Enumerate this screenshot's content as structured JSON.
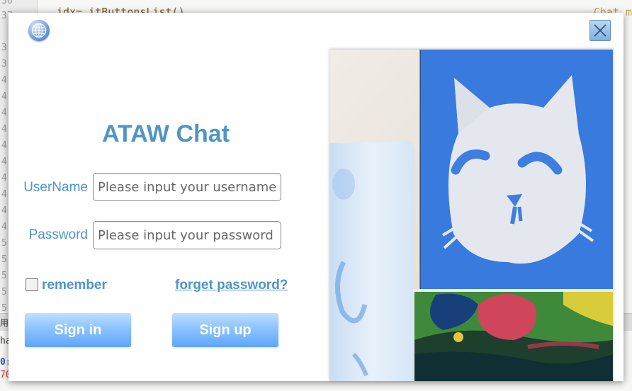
{
  "background_editor": {
    "gutter_numbers": [
      "36",
      "37",
      "3",
      "3",
      "4",
      "4",
      "4",
      "4",
      "4",
      "4",
      "4",
      "4",
      "4",
      "4",
      "5",
      "5",
      "5",
      "5",
      "5"
    ],
    "code_line": "    idx=    itButtonsList()",
    "code_right": "Chat m",
    "panel_char": "用",
    "panel_line_1": "ha",
    "panel_line_2": "0:",
    "panel_line_3": "70"
  },
  "dialog": {
    "globe_icon": "globe-icon",
    "close_icon": "close-icon",
    "title": "ATAW Chat",
    "username": {
      "label": "UserName",
      "value": "",
      "placeholder": "Please input your username"
    },
    "password": {
      "label": "Password",
      "value": "",
      "placeholder": "Please input your password"
    },
    "remember": {
      "label": "remember",
      "checked": false
    },
    "forgot_link": "forget password?",
    "sign_in_label": "Sign in",
    "sign_up_label": "Sign up",
    "picture": "painted-cat-artwork"
  },
  "colors": {
    "accent": "#4f95c6",
    "button_top": "#bfe0ff",
    "button_bottom": "#5ea6fb",
    "cat_background": "#3d7ee0"
  }
}
